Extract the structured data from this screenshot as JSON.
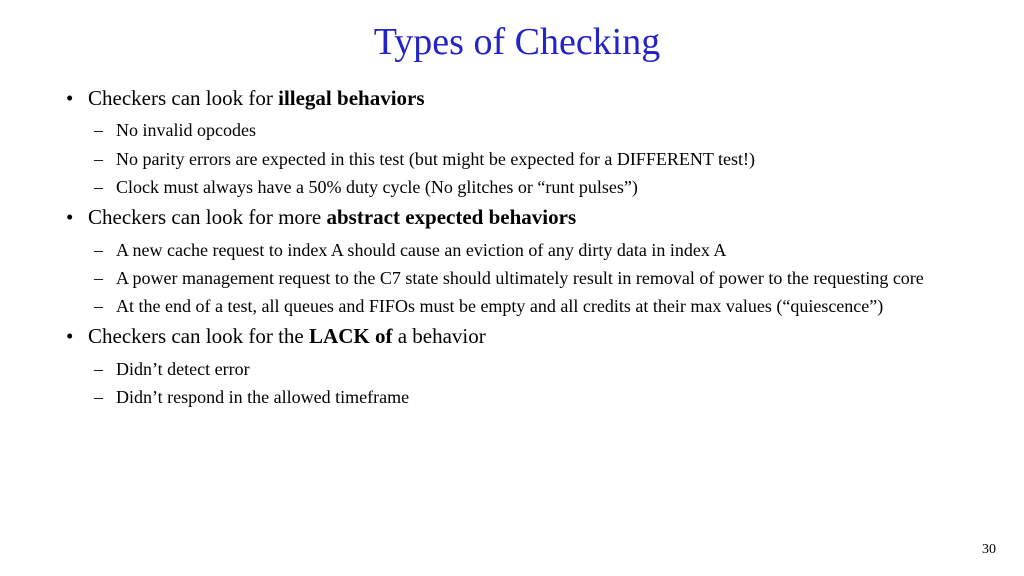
{
  "title": "Types of Checking",
  "bullets": [
    {
      "prefix": "Checkers can look for ",
      "bold": "illegal behaviors",
      "suffix": "",
      "sub": [
        "No invalid opcodes",
        "No parity errors are expected in this test (but might be expected for a DIFFERENT test!)",
        "Clock must always have a 50% duty cycle (No glitches or “runt pulses”)"
      ]
    },
    {
      "prefix": "Checkers can look for more ",
      "bold": "abstract expected behaviors",
      "suffix": "",
      "sub": [
        "A new cache request to index A should cause an eviction of any dirty data in index A",
        "A power management request to the C7 state should ultimately result in removal of power to the requesting core",
        "At the end of a test, all queues and FIFOs must be empty and all credits at their max values (“quiescence”)"
      ]
    },
    {
      "prefix": "Checkers can look for the ",
      "bold": "LACK of",
      "suffix": " a behavior",
      "sub": [
        "Didn’t detect error",
        "Didn’t respond in the allowed timeframe"
      ]
    }
  ],
  "page_number": "30"
}
